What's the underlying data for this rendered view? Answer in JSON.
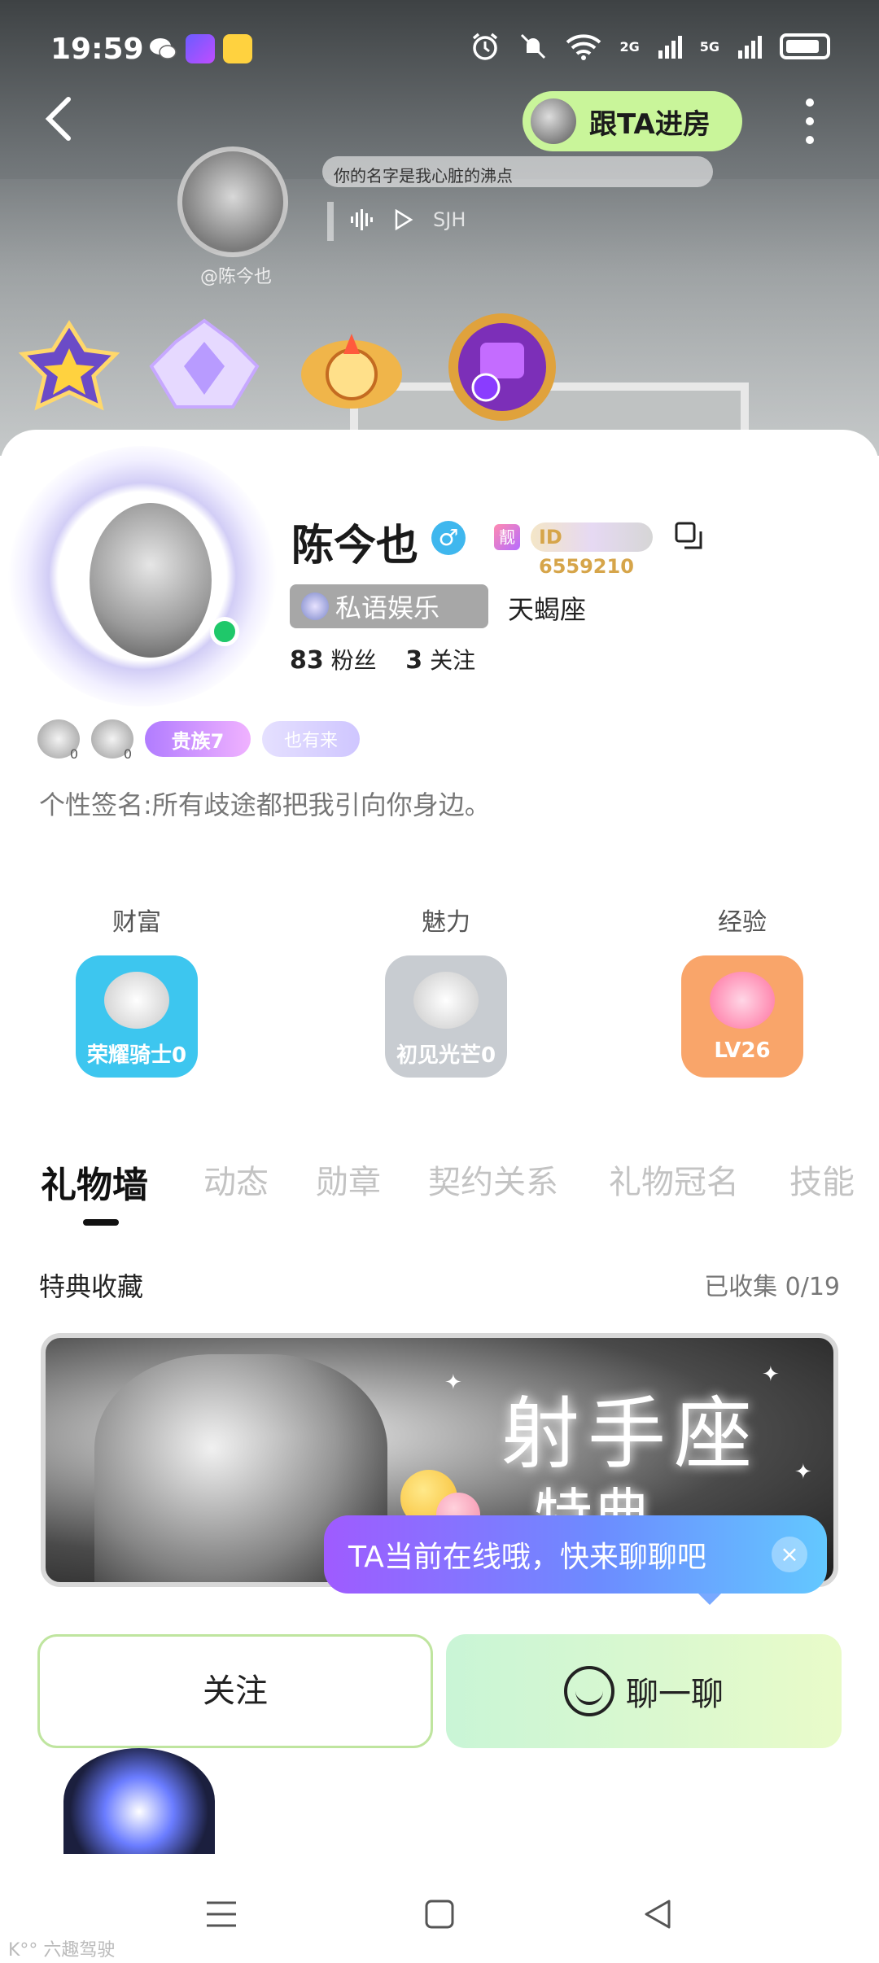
{
  "status_bar": {
    "time": "19:59",
    "network": [
      "2G",
      "5G"
    ],
    "icons": [
      "wechat-icon",
      "app-purple-icon",
      "app-yellow-icon",
      "alarm-icon",
      "mute-icon",
      "wifi-icon",
      "signal-icon",
      "battery-icon"
    ]
  },
  "header": {
    "follow_room_label": "跟TA进房"
  },
  "music": {
    "owner_handle": "@陈今也",
    "song_line": "你的名字是我心脏的沸点",
    "artist": "SJH"
  },
  "profile": {
    "nickname": "陈今也",
    "gender_symbol": "♂",
    "liang_tag": "靓",
    "id_text": "ID 6559210",
    "guild": "私语娱乐",
    "zodiac": "天蝎座",
    "fans_count": "83",
    "fans_label": "粉丝",
    "following_count": "3",
    "following_label": "关注",
    "medal_counts": [
      "0",
      "0"
    ],
    "noble_label": "贵族7",
    "extra_tag": "也有来",
    "signature": "个性签名:所有歧途都把我引向你身边。"
  },
  "stats": [
    {
      "label": "财富",
      "level": "荣耀骑士0",
      "count": "0",
      "color": "#3dc6ef"
    },
    {
      "label": "魅力",
      "level": "初见光芒0",
      "count": "0",
      "color": "#c8ccd1"
    },
    {
      "label": "经验",
      "level": "LV26",
      "count": "",
      "color": "#f9a56a"
    }
  ],
  "tabs": [
    "礼物墙",
    "动态",
    "勋章",
    "契约关系",
    "礼物冠名",
    "技能"
  ],
  "gift_section": {
    "title": "特典收藏",
    "collected": "已收集 0/19",
    "banner_title": "射手座",
    "banner_sub": "特典"
  },
  "chat_tip": {
    "text": "TA当前在线哦，快来聊聊吧",
    "close": "×"
  },
  "actions": {
    "follow": "关注",
    "chat": "聊一聊"
  },
  "watermark": "K°° 六趣驾驶"
}
